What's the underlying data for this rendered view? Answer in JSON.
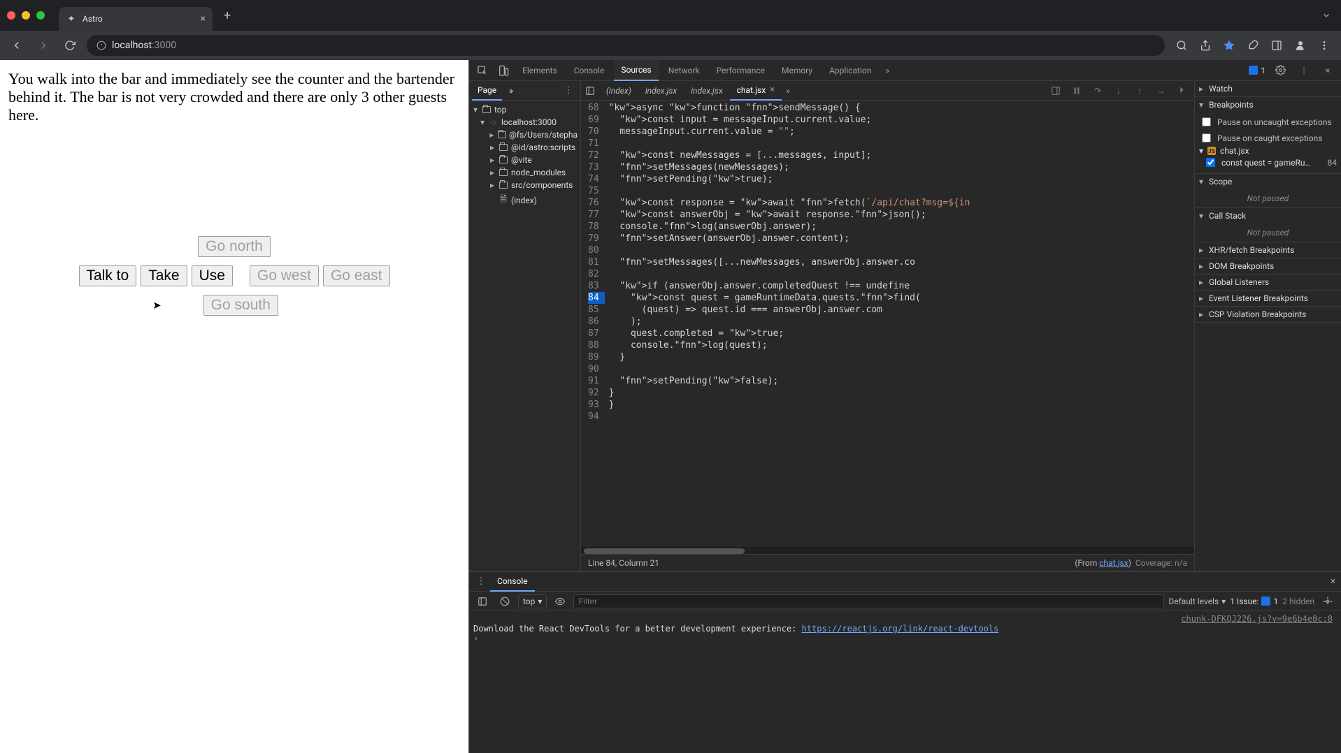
{
  "browser": {
    "tab_title": "Astro",
    "url_host": "localhost",
    "url_rest": ":3000"
  },
  "page": {
    "narrative": "You walk into the bar and immediately see the counter and the bartender behind it. The bar is not very crowded and there are only 3 other guests here.",
    "actions": {
      "talk": "Talk to",
      "take": "Take",
      "use": "Use"
    },
    "nav": {
      "north": "Go north",
      "west": "Go west",
      "east": "Go east",
      "south": "Go south"
    }
  },
  "devtools": {
    "tabs": [
      "Elements",
      "Console",
      "Sources",
      "Network",
      "Performance",
      "Memory",
      "Application"
    ],
    "active_tab": "Sources",
    "issues_count": "1",
    "nav": {
      "active": "Page",
      "top": "top",
      "host": "localhost:3000",
      "folders": [
        "@fs/Users/stepha",
        "@id/astro:scripts",
        "@vite",
        "node_modules",
        "src/components"
      ],
      "file_index": "(index)"
    },
    "files": {
      "tabs": [
        "(index)",
        "index.jsx",
        "index.jsx",
        "chat.jsx"
      ],
      "active": "chat.jsx"
    },
    "code": {
      "first_line": 68,
      "bp_line": 84,
      "lines": [
        "async function sendMessage() {",
        "  const input = messageInput.current.value;",
        "  messageInput.current.value = \"\";",
        "",
        "  const newMessages = [...messages, input];",
        "  setMessages(newMessages);",
        "  setPending(true);",
        "",
        "  const response = await fetch(`/api/chat?msg=${in",
        "  const answerObj = await response.json();",
        "  console.log(answerObj.answer);",
        "  setAnswer(answerObj.answer.content);",
        "",
        "  setMessages([...newMessages, answerObj.answer.co",
        "",
        "  if (answerObj.answer.completedQuest !== undefine",
        "    const quest = gameRuntimeData.quests.find(",
        "      (quest) => quest.id === answerObj.answer.com",
        "    );",
        "    quest.completed = true;",
        "    console.log(quest);",
        "  }",
        "",
        "  setPending(false);",
        "}",
        "}",
        ""
      ]
    },
    "status": {
      "pos": "Line 84, Column 21",
      "from": "(From ",
      "from_file": "chat.jsx",
      "from_close": ")",
      "coverage": "Coverage: n/a"
    },
    "panes": {
      "watch": "Watch",
      "breakpoints": {
        "title": "Breakpoints",
        "uncaught": "Pause on uncaught exceptions",
        "caught": "Pause on caught exceptions",
        "file": "chat.jsx",
        "expr": "const quest = gameRu…",
        "line": "84"
      },
      "scope": {
        "title": "Scope",
        "empty": "Not paused"
      },
      "callstack": {
        "title": "Call Stack",
        "empty": "Not paused"
      },
      "xhr": "XHR/fetch Breakpoints",
      "dom": "DOM Breakpoints",
      "gl": "Global Listeners",
      "ev": "Event Listener Breakpoints",
      "csp": "CSP Violation Breakpoints"
    },
    "console": {
      "title": "Console",
      "context": "top",
      "filter_placeholder": "Filter",
      "levels": "Default levels",
      "issue_label": "1 Issue:",
      "issue_n": "1",
      "hidden": "2 hidden",
      "src": "chunk-DFKQJ226.js?v=9e6b4e8c:8",
      "msg_pre": "Download the React DevTools for a better development experience: ",
      "msg_link": "https://reactjs.org/link/react-devtools"
    }
  }
}
